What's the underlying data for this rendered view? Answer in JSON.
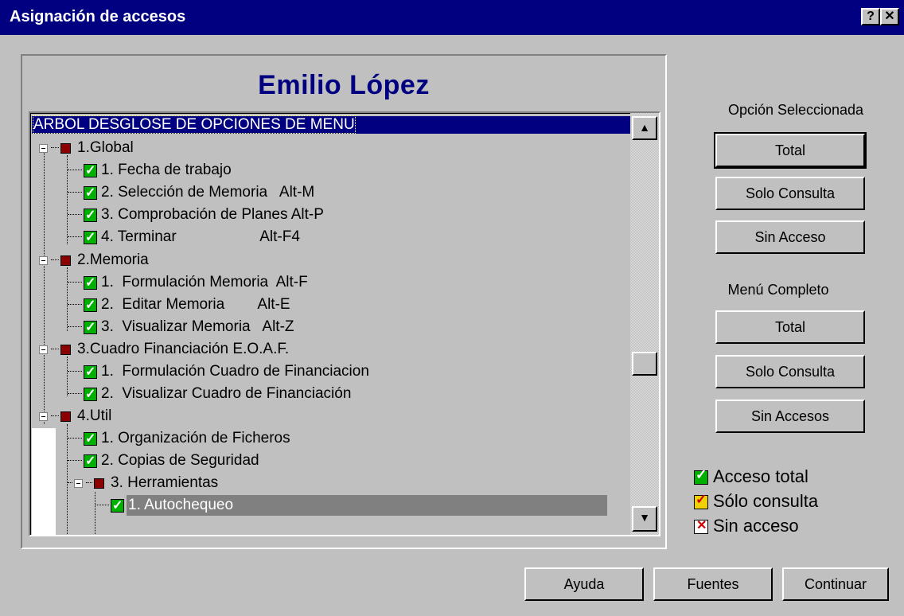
{
  "window": {
    "title": "Asignación de accesos",
    "help_btn": "?",
    "close_btn": "✕"
  },
  "user_name": "Emilio López",
  "tree": {
    "header": "ARBOL DESGLOSE DE OPCIONES DE MENU",
    "items": [
      {
        "label": "1.Global",
        "level": 0
      },
      {
        "label": "1. Fecha de trabajo",
        "level": 1
      },
      {
        "label": "2. Selección de Memoria   Alt-M",
        "level": 1
      },
      {
        "label": "3. Comprobación de Planes Alt-P",
        "level": 1
      },
      {
        "label": "4. Terminar                    Alt-F4",
        "level": 1
      },
      {
        "label": "2.Memoria",
        "level": 0
      },
      {
        "label": "1.  Formulación Memoria  Alt-F",
        "level": 1
      },
      {
        "label": "2.  Editar Memoria        Alt-E",
        "level": 1
      },
      {
        "label": "3.  Visualizar Memoria   Alt-Z",
        "level": 1
      },
      {
        "label": "3.Cuadro Financiación E.O.A.F.",
        "level": 0
      },
      {
        "label": "1.  Formulación Cuadro de Financiacion",
        "level": 1
      },
      {
        "label": "2.  Visualizar Cuadro de Financiación",
        "level": 1
      },
      {
        "label": "4.Util",
        "level": 0
      },
      {
        "label": "1. Organización de Ficheros",
        "level": 1
      },
      {
        "label": "2. Copias de Seguridad",
        "level": 1
      },
      {
        "label": "3. Herramientas",
        "level": 1
      },
      {
        "label": "1. Autochequeo",
        "level": 2
      }
    ],
    "scroll_up": "▲",
    "scroll_down": "▼"
  },
  "selected_option": {
    "label": "Opción Seleccionada",
    "total": "Total",
    "read_only": "Solo Consulta",
    "no_access": "Sin Acceso"
  },
  "full_menu": {
    "label": "Menú Completo",
    "total": "Total",
    "read_only": "Solo Consulta",
    "no_access": "Sin Accesos"
  },
  "legend": {
    "full": "Acceso total",
    "read_only": "Sólo consulta",
    "none": "Sin acceso"
  },
  "footer": {
    "help": "Ayuda",
    "fonts": "Fuentes",
    "continue": "Continuar"
  },
  "colors": {
    "title_bar": "#000080",
    "face": "#c0c0c0",
    "user_name": "#000080",
    "access_full": "#00b000",
    "access_read": "#f0d000",
    "branch_marker": "#8b0000"
  }
}
